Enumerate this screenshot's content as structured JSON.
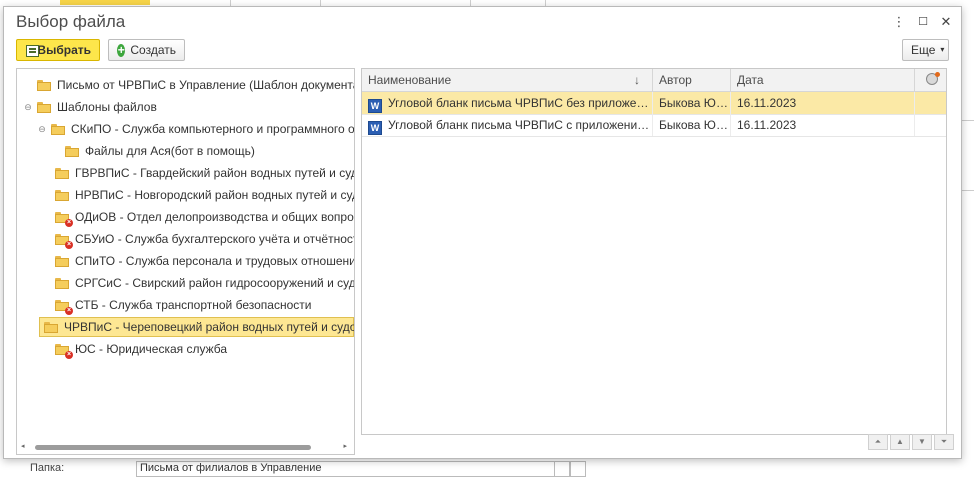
{
  "dialog": {
    "title": "Выбор файла",
    "menu_icon": "⋮",
    "maximize_icon": "☐",
    "close_icon": "✕"
  },
  "toolbar": {
    "choose_label": "Выбрать",
    "create_label": "Создать",
    "more_label": "Еще"
  },
  "tree": {
    "items": [
      {
        "label": "Письмо от ЧРВПиС в Управление (Шаблон документа)",
        "level": 0,
        "toggle": "",
        "deleted": false,
        "selected": false
      },
      {
        "label": "Шаблоны файлов",
        "level": 0,
        "toggle": "⊖",
        "deleted": false,
        "selected": false
      },
      {
        "label": "СКиПО - Служба компьютерного и программного обеспечения",
        "level": 1,
        "toggle": "⊖",
        "deleted": false,
        "selected": false
      },
      {
        "label": "Файлы для Ася(бот в помощь)",
        "level": 2,
        "toggle": "",
        "deleted": false,
        "selected": false
      },
      {
        "label": "ГВРВПиС - Гвардейский район водных путей и судоходства",
        "level": 1,
        "toggle": "",
        "deleted": false,
        "selected": false
      },
      {
        "label": "НРВПиС - Новгородский район водных путей и судоходства",
        "level": 1,
        "toggle": "",
        "deleted": false,
        "selected": false
      },
      {
        "label": "ОДиОВ - Отдел делопроизводства и общих вопросов",
        "level": 1,
        "toggle": "",
        "deleted": true,
        "selected": false
      },
      {
        "label": "СБУиО - Служба бухгалтерского учёта и отчётности",
        "level": 1,
        "toggle": "",
        "deleted": true,
        "selected": false
      },
      {
        "label": "СПиТО - Служба персонала и трудовых отношений",
        "level": 1,
        "toggle": "",
        "deleted": false,
        "selected": false
      },
      {
        "label": "СРГСиС - Свирский район гидросооружений и судоходства",
        "level": 1,
        "toggle": "",
        "deleted": false,
        "selected": false
      },
      {
        "label": "СТБ - Служба транспортной безопасности",
        "level": 1,
        "toggle": "",
        "deleted": true,
        "selected": false
      },
      {
        "label": "ЧРВПиС - Череповецкий район водных путей и судоходства",
        "level": 1,
        "toggle": "",
        "deleted": false,
        "selected": true
      },
      {
        "label": "ЮС - Юридическая служба",
        "level": 1,
        "toggle": "",
        "deleted": true,
        "selected": false
      }
    ],
    "scroll_left": "◂",
    "scroll_right": "▸"
  },
  "grid": {
    "columns": [
      "Наименование",
      "Автор",
      "Дата"
    ],
    "sort_indicator": "↓",
    "rows": [
      {
        "name": "Угловой бланк письма ЧРВПиС без приложения с подписью",
        "author": "Быкова Ю.А.",
        "date": "16.11.2023",
        "selected": true
      },
      {
        "name": "Угловой бланк письма ЧРВПиС с приложением с подписью",
        "author": "Быкова Ю.А.",
        "date": "16.11.2023",
        "selected": false
      }
    ],
    "file_icon_letter": "W"
  },
  "background": {
    "field_label": "Папка:",
    "field_value": "Письма от филиалов в Управление"
  }
}
